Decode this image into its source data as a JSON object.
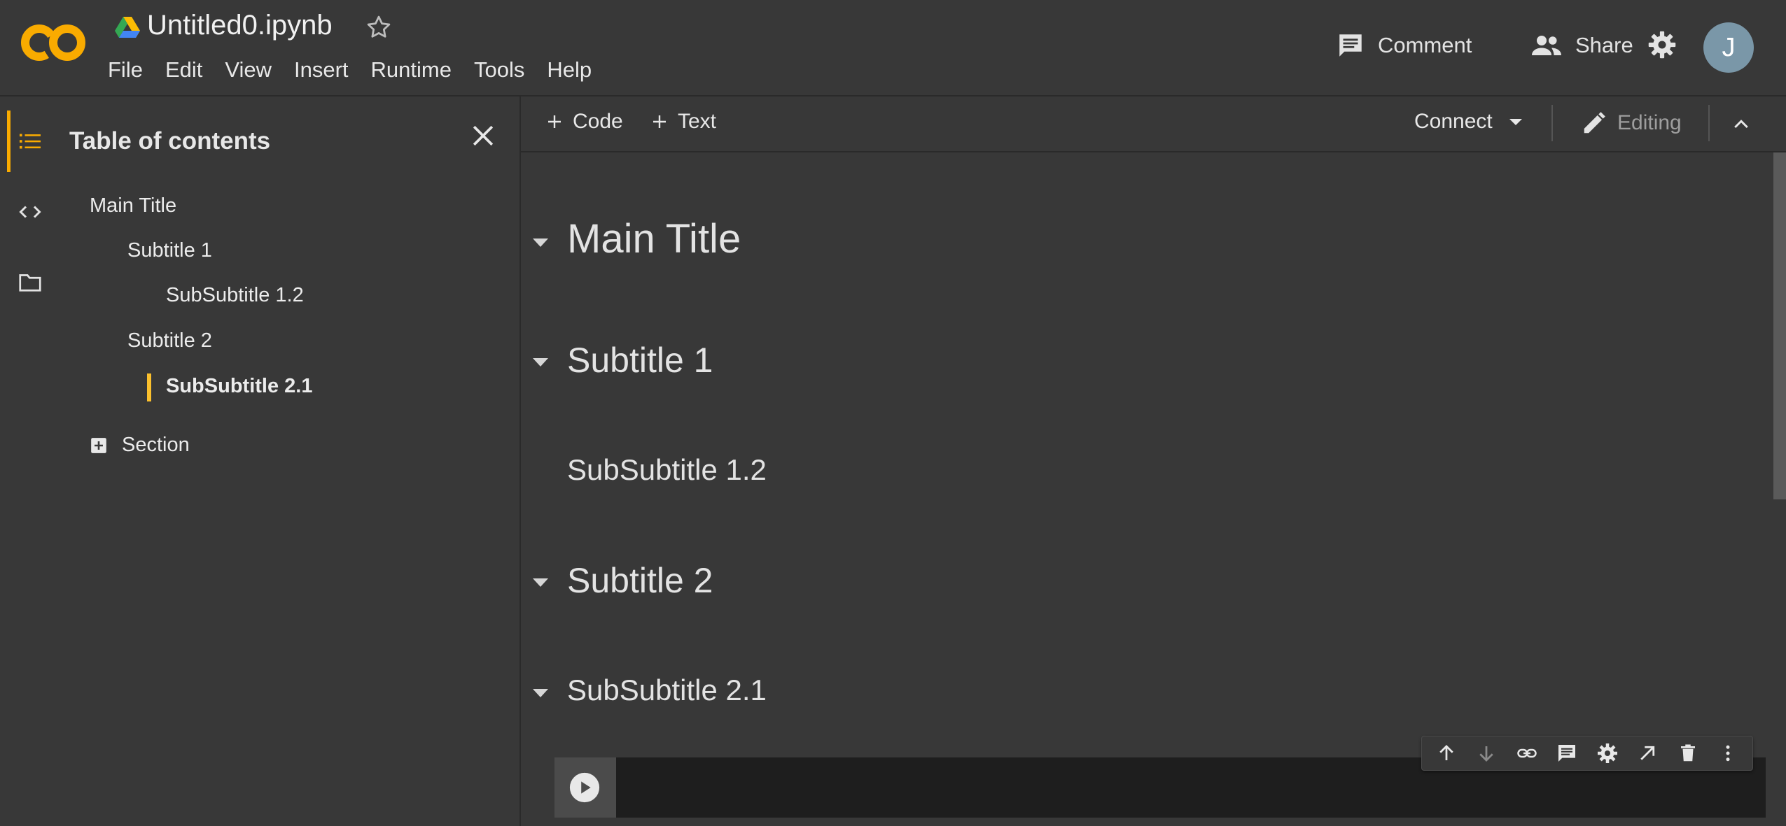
{
  "header": {
    "notebook_title": "Untitled0.ipynb",
    "menu": [
      "File",
      "Edit",
      "View",
      "Insert",
      "Runtime",
      "Tools",
      "Help"
    ],
    "comment_label": "Comment",
    "share_label": "Share",
    "avatar_letter": "J"
  },
  "sidebar": {
    "title": "Table of contents",
    "items": [
      {
        "label": "Main Title",
        "level": 1
      },
      {
        "label": "Subtitle 1",
        "level": 2
      },
      {
        "label": "SubSubtitle 1.2",
        "level": 3
      },
      {
        "label": "Subtitle 2",
        "level": 2
      },
      {
        "label": "SubSubtitle 2.1",
        "level": 3,
        "active": true
      }
    ],
    "add_section_label": "Section"
  },
  "toolbar": {
    "code_label": "Code",
    "text_label": "Text",
    "connect_label": "Connect",
    "editing_label": "Editing"
  },
  "notebook": {
    "headings": [
      "Main Title",
      "Subtitle 1",
      "SubSubtitle 1.2",
      "Subtitle 2",
      "SubSubtitle 2.1"
    ]
  },
  "colors": {
    "accent": "#f9ab00",
    "active_marker": "#fbc02d",
    "background": "#383838",
    "code_cell": "#1e1e1e"
  },
  "icons": {
    "rail": [
      "toc-icon",
      "code-snippets-icon",
      "folder-icon"
    ],
    "cell_toolbar": [
      "move-up-icon",
      "move-down-icon",
      "link-icon",
      "comment-icon",
      "settings-icon",
      "open-in-editor-icon",
      "delete-icon",
      "more-icon"
    ]
  }
}
